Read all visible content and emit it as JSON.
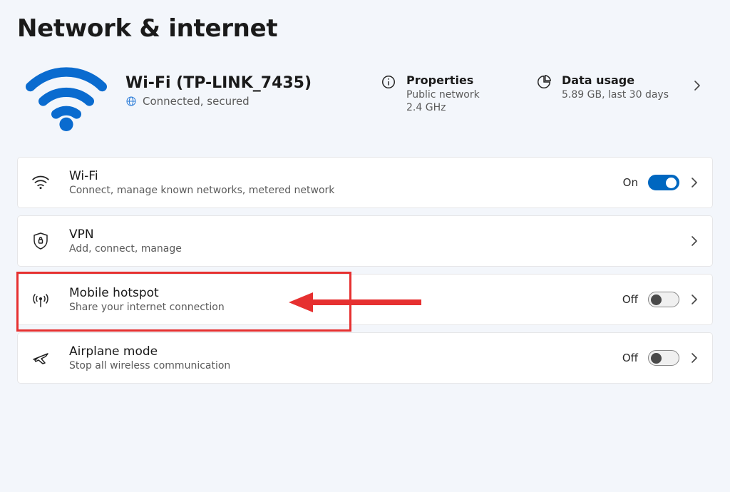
{
  "pageTitle": "Network & internet",
  "connection": {
    "title": "Wi-Fi (TP-LINK_7435)",
    "statusText": "Connected, secured"
  },
  "properties": {
    "title": "Properties",
    "line1": "Public network",
    "line2": "2.4 GHz"
  },
  "dataUsage": {
    "title": "Data usage",
    "line1": "5.89 GB, last 30 days"
  },
  "items": {
    "wifi": {
      "title": "Wi-Fi",
      "desc": "Connect, manage known networks, metered network",
      "state": "On"
    },
    "vpn": {
      "title": "VPN",
      "desc": "Add, connect, manage"
    },
    "hotspot": {
      "title": "Mobile hotspot",
      "desc": "Share your internet connection",
      "state": "Off"
    },
    "airplane": {
      "title": "Airplane mode",
      "desc": "Stop all wireless communication",
      "state": "Off"
    }
  },
  "annotation": {
    "target": "hotspot",
    "style": "red-box-with-arrow"
  }
}
